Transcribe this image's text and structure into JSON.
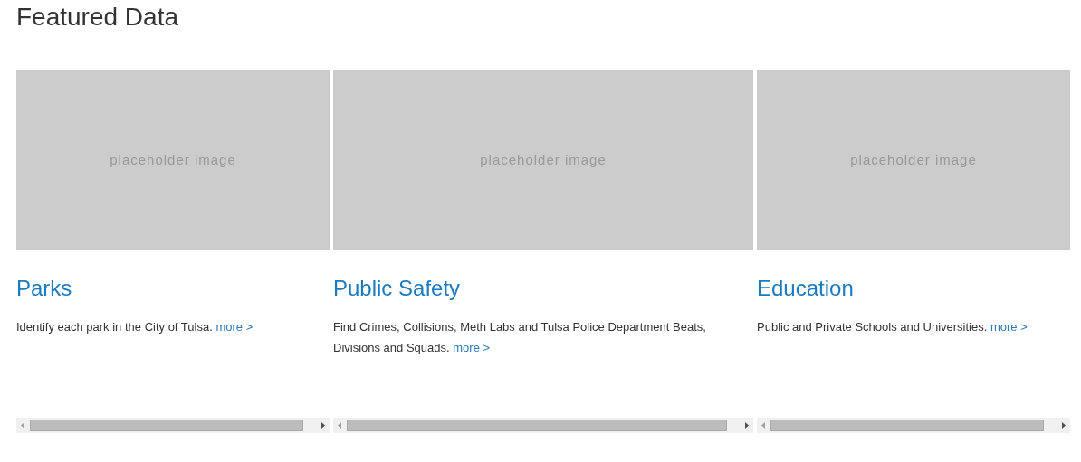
{
  "heading": "Featured Data",
  "cards": [
    {
      "image_label": "placeholder image",
      "title": "Parks",
      "description": "Identify each park in the City of Tulsa.",
      "link": "more >"
    },
    {
      "image_label": "placeholder image",
      "title": "Public Safety",
      "description": "Find Crimes, Collisions, Meth Labs and Tulsa Police Department Beats, Divisions and Squads.",
      "link": "more >"
    },
    {
      "image_label": "placeholder image",
      "title": "Education",
      "description": "Public and Private Schools and Universities.",
      "link": "more >"
    }
  ]
}
